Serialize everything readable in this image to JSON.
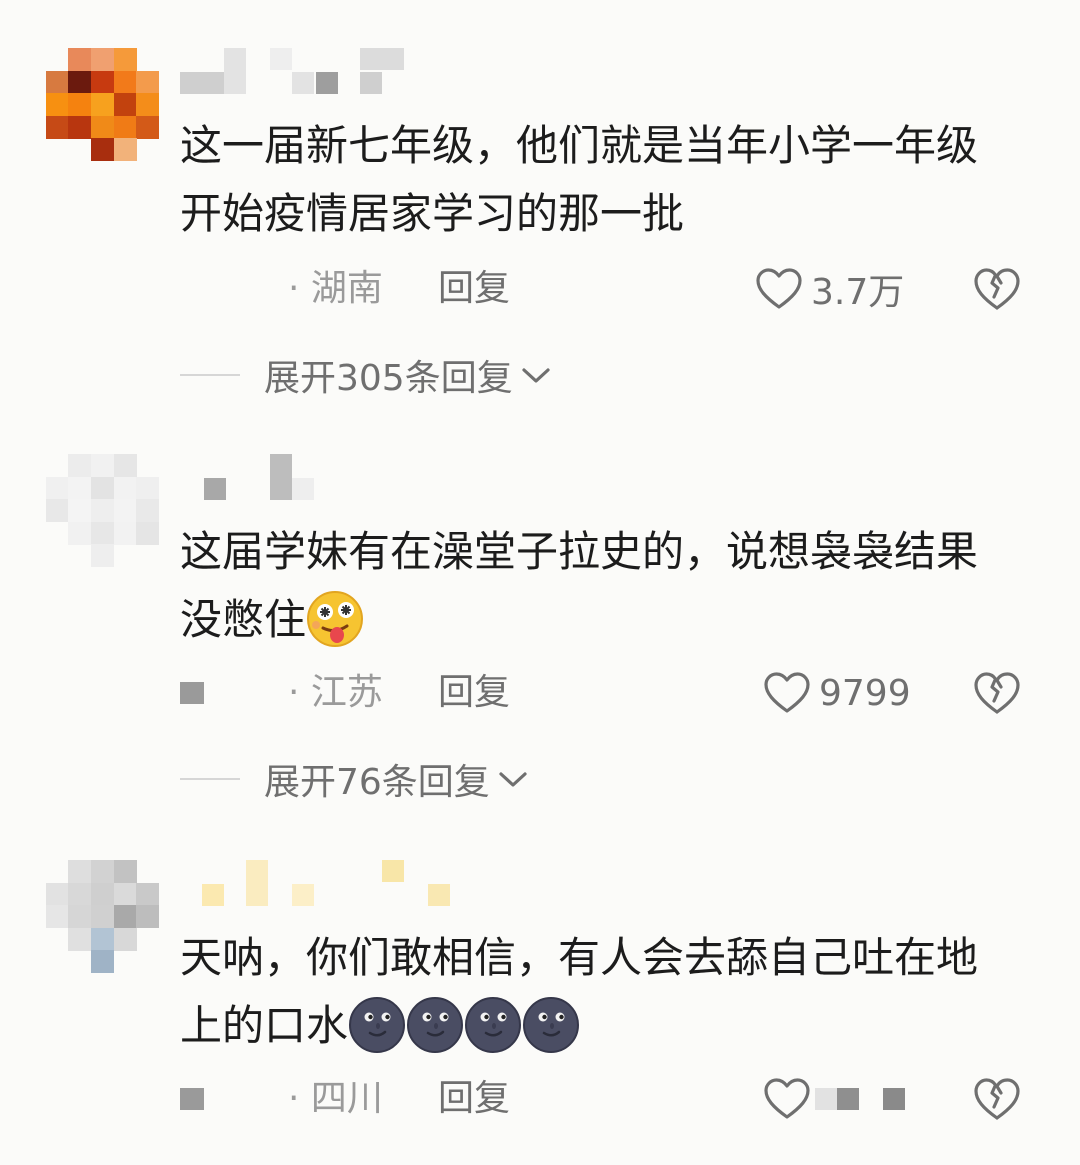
{
  "comments": [
    {
      "text": "这一届新七年级，他们就是当年小学一年级开始疫情居家学习的那一批",
      "location": "· 湖南",
      "reply_label": "回复",
      "likes": "3.7万",
      "expand_label": "展开305条回复"
    },
    {
      "text": "这届学妹有在澡堂子拉史的，说想袅袅结果没憋住",
      "location": "· 江苏",
      "reply_label": "回复",
      "likes": "9799",
      "expand_label": "展开76条回复"
    },
    {
      "text": "天呐，你们敢相信，有人会去舔自己吐在地上的口水",
      "location": "· 四川",
      "reply_label": "回复"
    }
  ],
  "icons": {
    "like": "heart-outline-icon",
    "dislike": "broken-heart-icon",
    "expand": "chevron-down-icon",
    "emoji_2": "dizzy-tongue-emoji",
    "emoji_3": "new-moon-face-emoji"
  },
  "colors": {
    "text": "#1c1c1c",
    "secondary": "#6f6f6f",
    "muted": "#9a9a9a",
    "background": "#fbfbf9"
  }
}
